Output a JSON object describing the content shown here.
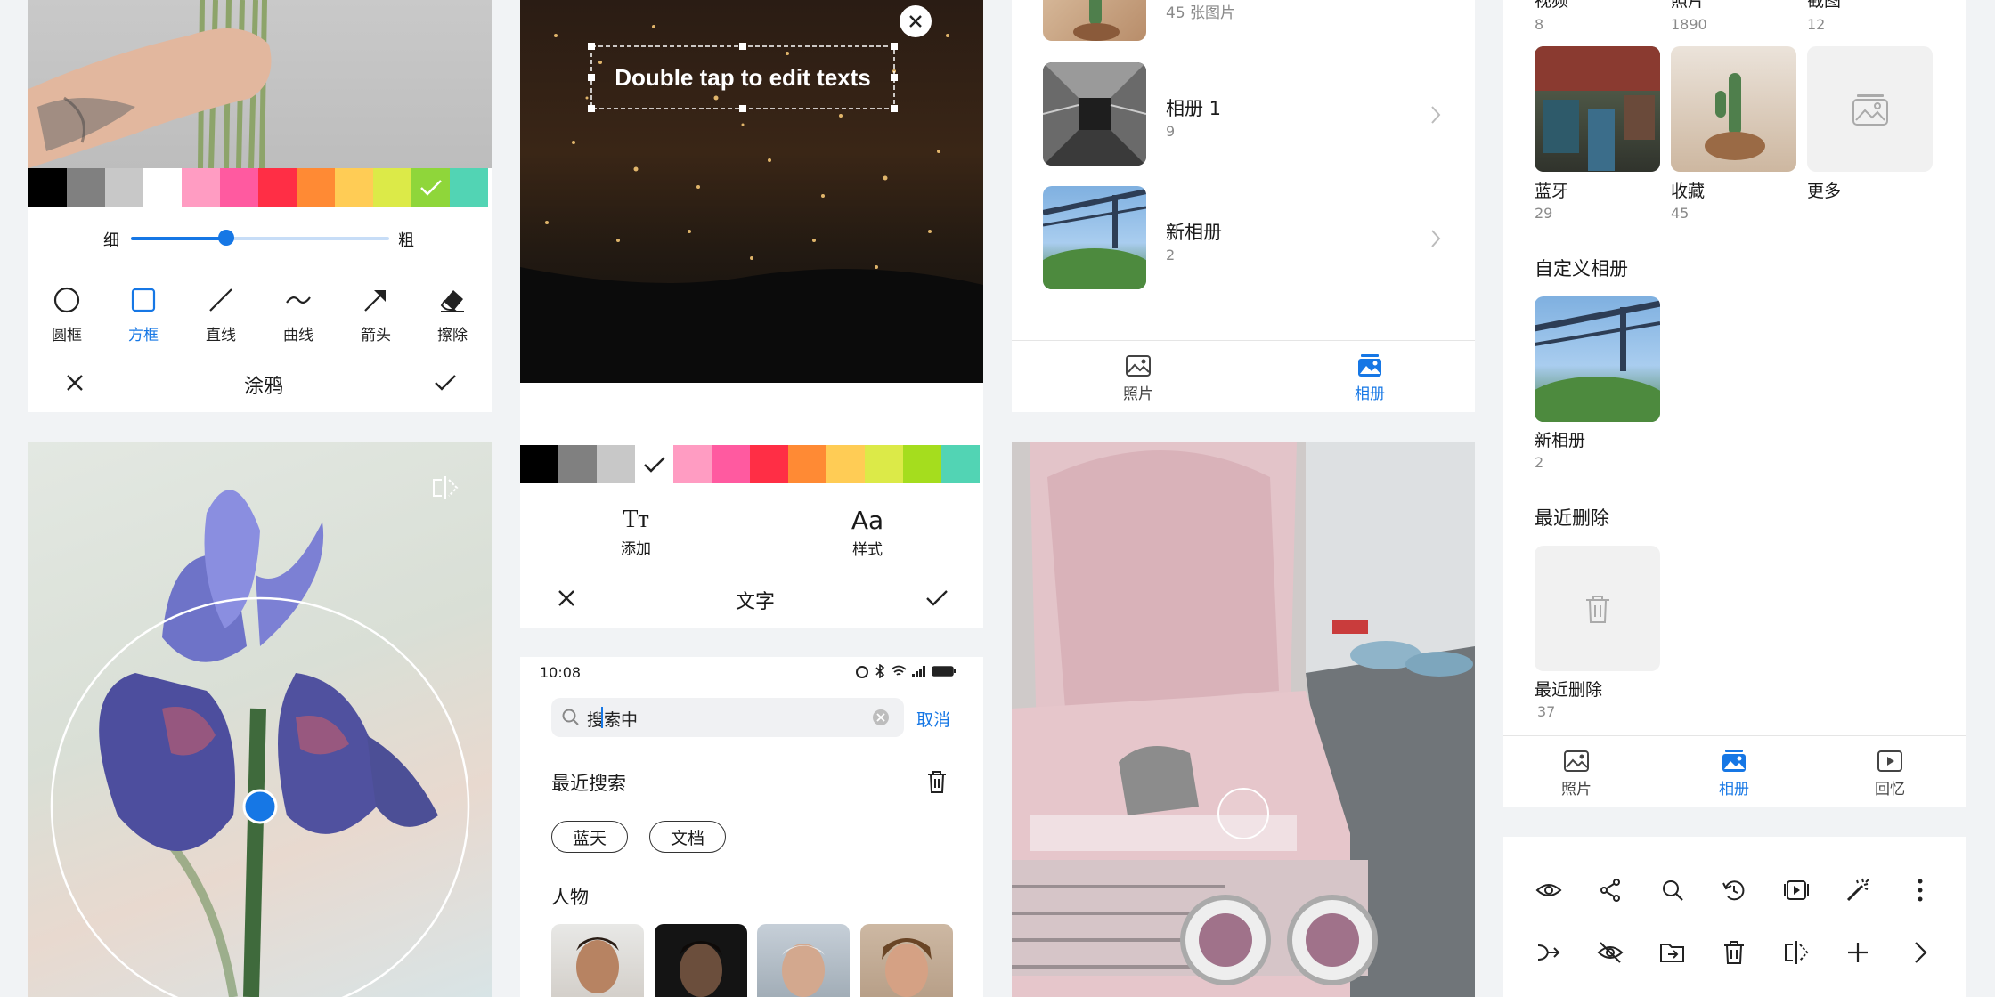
{
  "doodle": {
    "thin_label": "细",
    "thick_label": "粗",
    "brush_level": 0.37,
    "tools": [
      {
        "label": "圆框",
        "icon": "circle-icon"
      },
      {
        "label": "方框",
        "icon": "square-icon"
      },
      {
        "label": "直线",
        "icon": "line-icon"
      },
      {
        "label": "曲线",
        "icon": "curve-icon"
      },
      {
        "label": "箭头",
        "icon": "arrow-icon"
      },
      {
        "label": "擦除",
        "icon": "eraser-icon"
      }
    ],
    "active_tool": 1,
    "title": "涂鸦",
    "colors": [
      "#000000",
      "#808080",
      "#c8c8c8",
      "#ffffff",
      "#ff9cc2",
      "#ff5aa0",
      "#ff2e45",
      "#ff8a34",
      "#ffcc55",
      "#dcea48",
      "#8fd63a",
      "#52d4b4"
    ],
    "selected_color": 10
  },
  "text_editor": {
    "overlay_text": "Double tap to edit texts",
    "add_label": "添加",
    "style_label": "样式",
    "add_glyph": "Tт",
    "style_glyph": "Aa",
    "title": "文字",
    "colors": [
      "#000000",
      "#808080",
      "#c8c8c8",
      "#ffffff",
      "#ff9cc2",
      "#ff5aa0",
      "#ff2e45",
      "#ff8a34",
      "#ffcc55",
      "#dcea48",
      "#a5dd1e",
      "#52d4b4"
    ],
    "selected_color": 3
  },
  "search": {
    "time": "10:08",
    "query": "搜索中",
    "cancel_label": "取消",
    "recent_title": "最近搜索",
    "chips": [
      "蓝天",
      "文档"
    ],
    "people_title": "人物"
  },
  "albums_list": {
    "top_count": "45 张图片",
    "items": [
      {
        "name": "相册 1",
        "count": "9"
      },
      {
        "name": "新相册",
        "count": "2"
      }
    ],
    "tabs": [
      {
        "label": "照片",
        "icon": "photo-icon"
      },
      {
        "label": "相册",
        "icon": "album-icon"
      }
    ],
    "active_tab": 1
  },
  "albums_grid": {
    "top_row": [
      {
        "name": "视频",
        "count": "8"
      },
      {
        "name": "照片",
        "count": "1890"
      },
      {
        "name": "截图",
        "count": "12"
      }
    ],
    "second_row": [
      {
        "name": "蓝牙",
        "count": "29"
      },
      {
        "name": "收藏",
        "count": "45"
      },
      {
        "name": "更多",
        "count": ""
      }
    ],
    "custom_title": "自定义相册",
    "custom_album": {
      "name": "新相册",
      "count": "2"
    },
    "deleted_title": "最近删除",
    "deleted_album": {
      "name": "最近删除",
      "count": "37"
    },
    "tabs": [
      {
        "label": "照片",
        "icon": "photo-icon"
      },
      {
        "label": "相册",
        "icon": "album-icon"
      },
      {
        "label": "回忆",
        "icon": "memories-icon"
      }
    ],
    "active_tab": 1
  },
  "toolbar_icons": {
    "row1": [
      "eye-icon",
      "share-icon",
      "search-icon",
      "restore-icon",
      "slideshow-icon",
      "magic-wand-icon",
      "more-icon"
    ],
    "row2": [
      "merge-icon",
      "hide-icon",
      "move-folder-icon",
      "trash-icon",
      "compare-icon",
      "add-icon",
      "chevron-right-icon"
    ]
  }
}
